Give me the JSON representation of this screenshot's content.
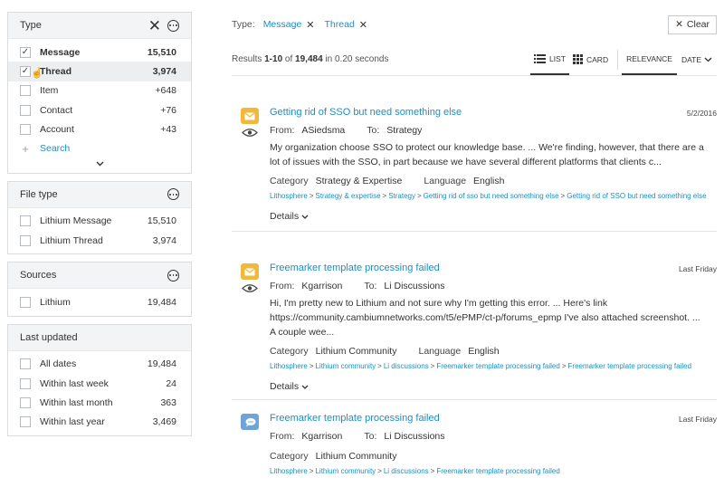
{
  "facets": {
    "type": {
      "title": "Type",
      "items": [
        {
          "label": "Message",
          "count": "15,510",
          "checked": true,
          "bold": true
        },
        {
          "label": "Thread",
          "count": "3,974",
          "checked": true,
          "bold": true
        },
        {
          "label": "Item",
          "count": "+648"
        },
        {
          "label": "Contact",
          "count": "+76"
        },
        {
          "label": "Account",
          "count": "+43"
        }
      ],
      "search_label": "Search"
    },
    "file_type": {
      "title": "File type",
      "items": [
        {
          "label": "Lithium Message",
          "count": "15,510"
        },
        {
          "label": "Lithium Thread",
          "count": "3,974"
        }
      ]
    },
    "sources": {
      "title": "Sources",
      "items": [
        {
          "label": "Lithium",
          "count": "19,484"
        }
      ]
    },
    "last_updated": {
      "title": "Last updated",
      "items": [
        {
          "label": "All dates",
          "count": "19,484"
        },
        {
          "label": "Within last week",
          "count": "24"
        },
        {
          "label": "Within last month",
          "count": "363"
        },
        {
          "label": "Within last year",
          "count": "3,469"
        }
      ]
    }
  },
  "filterbar": {
    "label": "Type:",
    "chips": [
      "Message",
      "Thread"
    ],
    "clear_label": "Clear"
  },
  "results_bar": {
    "prefix": "Results ",
    "range": "1-10",
    "of": " of ",
    "total": "19,484",
    "suffix": " in 0.20 seconds",
    "view_list": "LIST",
    "view_card": "CARD",
    "sort_relevance": "RELEVANCE",
    "sort_date": "DATE"
  },
  "results": [
    {
      "title": "Getting rid of SSO but need something else",
      "date": "5/2/2016",
      "from_label": "From:",
      "from": "ASiedsma",
      "to_label": "To:",
      "to": "Strategy",
      "snippet": "My organization choose SSO to protect our knowledge base. ... We're finding, however, that there are a lot of issues with the SSO, in part because we have several different platforms that clients c...",
      "category_label": "Category",
      "category": "Strategy & Expertise",
      "language_label": "Language",
      "language": "English",
      "crumbs": [
        "Lithosphere",
        "Strategy & expertise",
        "Strategy",
        "Getting rid of sso but need something else",
        "Getting rid of SSO but need something else"
      ],
      "details": "Details"
    },
    {
      "title": "Freemarker template processing failed",
      "date": "Last Friday",
      "from_label": "From:",
      "from": "Kgarrison",
      "to_label": "To:",
      "to": "Li Discussions",
      "snippet": "Hi, I'm pretty new to Lithium and not sure why I'm getting this error. ... Here's link https://community.cambiumnetworks.com/t5/ePMP/ct-p/forums_epmp I've also attached screenshot. ... A couple wee...",
      "category_label": "Category",
      "category": "Lithium Community",
      "language_label": "Language",
      "language": "English",
      "crumbs": [
        "Lithosphere",
        "Lithium community",
        "Li discussions",
        "Freemarker template processing failed",
        "Freemarker template processing failed"
      ],
      "details": "Details"
    },
    {
      "title": "Freemarker template processing failed",
      "date": "Last Friday",
      "from_label": "From:",
      "from": "Kgarrison",
      "to_label": "To:",
      "to": "Li Discussions",
      "category_label": "Category",
      "category": "Lithium Community",
      "crumbs": [
        "Lithosphere",
        "Lithium community",
        "Li discussions",
        "Freemarker template processing failed"
      ]
    }
  ],
  "icons": {
    "envelope": "envelope-icon",
    "thread": "thread-icon",
    "eye": "eye-icon"
  },
  "colors": {
    "link": "#1a8fc4",
    "message_icon": "#f0b93a",
    "thread_icon": "#6fa4db"
  }
}
